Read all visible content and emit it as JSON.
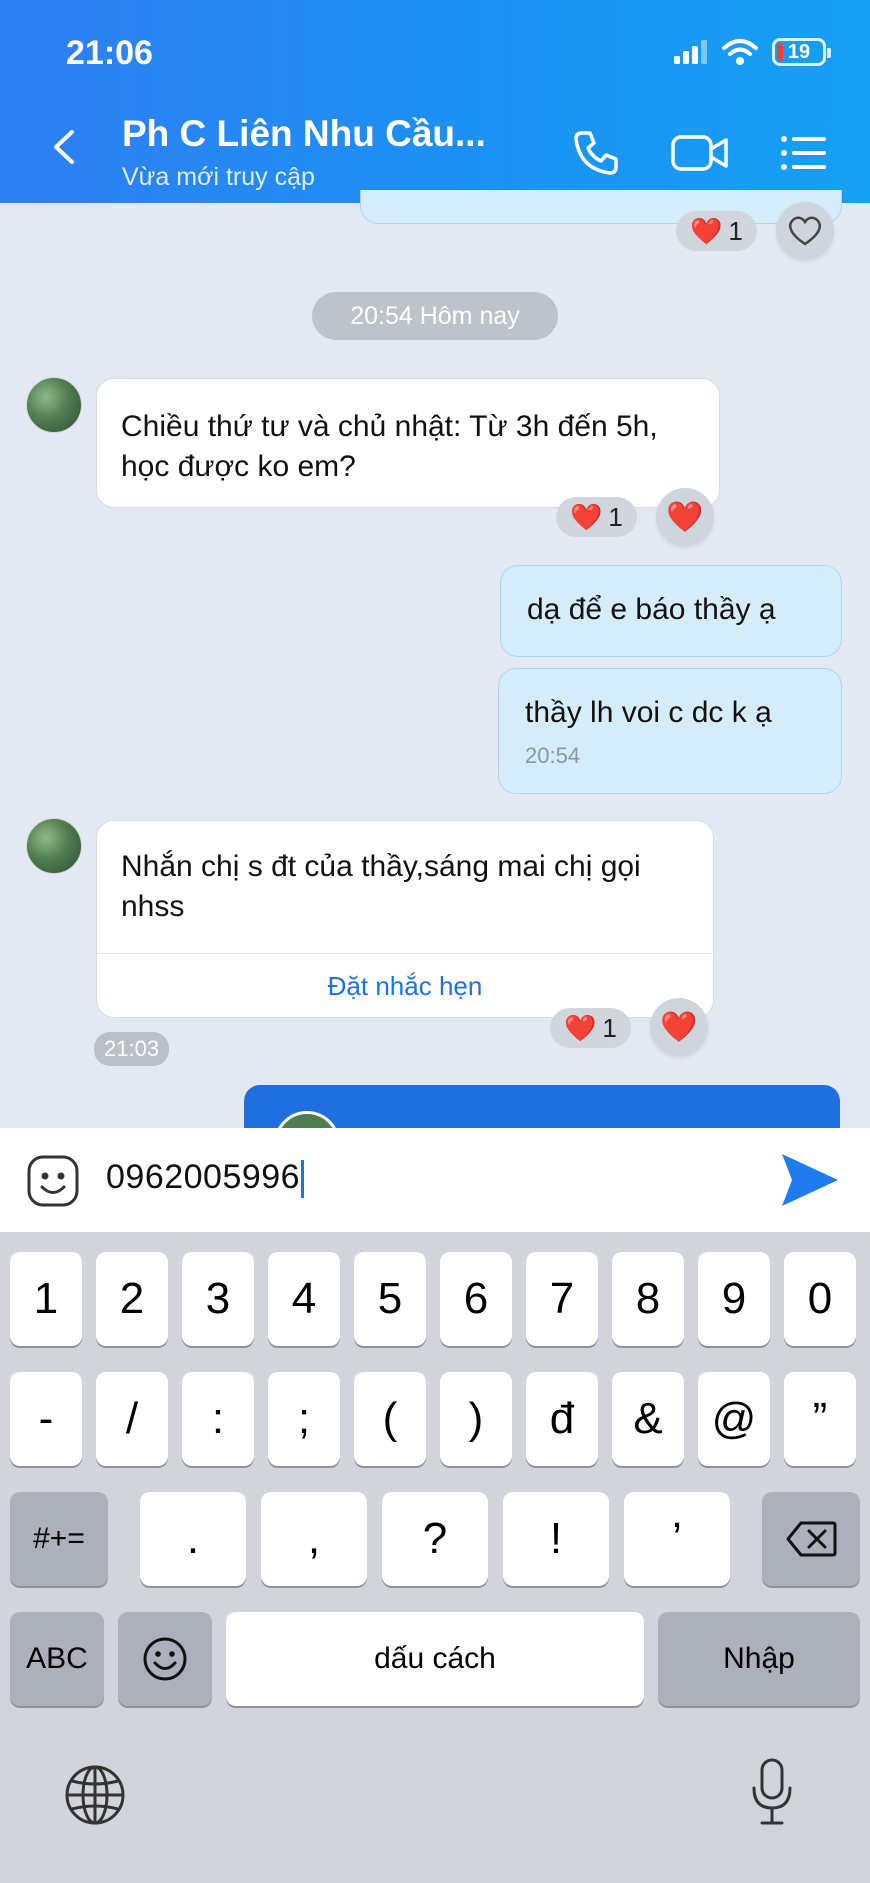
{
  "status_bar": {
    "time": "21:06",
    "battery": "19"
  },
  "header": {
    "title": "Ph C Liên Nhu Cầu...",
    "subtitle": "Vừa mới truy cập"
  },
  "chat": {
    "top_reaction_count": "1",
    "date_separator": "20:54 Hôm nay",
    "messages": [
      {
        "text": "Chiều thứ tư và chủ nhật: Từ 3h đến 5h, học được ko em?",
        "reaction_count": "1"
      },
      {
        "text": "dạ để e báo thầy ạ"
      },
      {
        "text": "thầy lh voi c dc k ạ",
        "time": "20:54"
      },
      {
        "text": "Nhắn chị s đt của thầy,sáng mai chị gọi nhss",
        "action": "Đặt nhắc hẹn",
        "reaction_count": "1",
        "time": "21:03"
      }
    ]
  },
  "input": {
    "value": "0962005996"
  },
  "keyboard": {
    "row1": [
      "1",
      "2",
      "3",
      "4",
      "5",
      "6",
      "7",
      "8",
      "9",
      "0"
    ],
    "row2": [
      "-",
      "/",
      ":",
      ";",
      "(",
      ")",
      "đ",
      "&",
      "@",
      "”"
    ],
    "row3": [
      ".",
      ",",
      "?",
      "!",
      "’"
    ],
    "symbols_key": "#+=",
    "abc_key": "ABC",
    "space_key": "dấu cách",
    "return_key": "Nhập"
  },
  "colors": {
    "header": "#2f7ff2",
    "bubble_out": "#d5ecfb",
    "accent": "#1a73e8",
    "heart": "#e8202c"
  }
}
